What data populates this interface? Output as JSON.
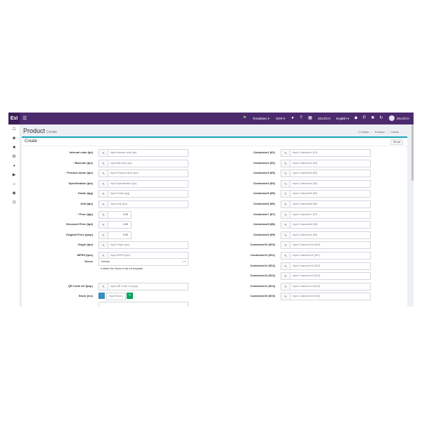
{
  "app": {
    "brand": "EsI",
    "menu_icon": "hamburger-icon",
    "top": {
      "templates": "Templates",
      "currency": "SGR",
      "user_label": "2014/CH",
      "language": "English",
      "user_name": "2014/CH"
    }
  },
  "page": {
    "title": "Product",
    "subtitle": "Create",
    "breadcrumb": [
      "Home",
      "Product",
      "Create"
    ]
  },
  "box": {
    "title": "Create",
    "list_label": "List"
  },
  "left_fields": [
    {
      "label": "Internal code (Ipi)",
      "required": false,
      "placeholder": "Input Internal code (Ipi)"
    },
    {
      "label": "Barcode (Ipc)",
      "required": true,
      "placeholder": "Input Barcode (Ipc)"
    },
    {
      "label": "Product name (Ipn)",
      "required": true,
      "placeholder": "Input Product name (Ipn)"
    },
    {
      "label": "Specification (Ips)",
      "required": false,
      "placeholder": "Input Specification (Ips)"
    },
    {
      "label": "Grade (Ipg)",
      "required": false,
      "placeholder": "Input Grade (Ipg)"
    },
    {
      "label": "Unit (Ipu)",
      "required": false,
      "placeholder": "Input Unit (Ipu)"
    },
    {
      "label": "Price (Ipp)",
      "required": true,
      "value": "0.00"
    },
    {
      "label": "Discount Price (Ipd)",
      "required": false,
      "value": "0.00"
    },
    {
      "label": "Original Price (Ipop)",
      "required": false,
      "value": "0.00"
    },
    {
      "label": "Origin (Ipo)",
      "required": false,
      "placeholder": "Input Origin (Ipo)"
    },
    {
      "label": "MFRS (Ipm)",
      "required": false,
      "placeholder": "Input MFRS (Ipm)"
    }
  ],
  "scene": {
    "label": "Scene",
    "value": "Normal",
    "note": "Match the Scene in the ed template"
  },
  "qr": {
    "label": "QR Code Url (Ipqr)",
    "placeholder": "Input QR Code Url (Ipqr)"
  },
  "stock": {
    "label": "Stock (Ivc)",
    "placeholder": "Input Stock (",
    "plus": "+"
  },
  "right_fields": [
    {
      "label": "Customize1 (If1)",
      "placeholder": "Input Customize1 (If1)"
    },
    {
      "label": "Customize2 (If2)",
      "placeholder": "Input Customize2 (If2)"
    },
    {
      "label": "Customize3 (If3)",
      "placeholder": "Input Customize3 (If3)"
    },
    {
      "label": "Customize4 (If4)",
      "placeholder": "Input Customize4 (If4)"
    },
    {
      "label": "Customize5 (If5)",
      "placeholder": "Input Customize5 (If5)"
    },
    {
      "label": "Customize6 (If6)",
      "placeholder": "Input Customize6 (If6)"
    },
    {
      "label": "Customize7 (If7)",
      "placeholder": "Input Customize7 (If7)"
    },
    {
      "label": "Customize8 (If8)",
      "placeholder": "Input Customize8 (If8)"
    },
    {
      "label": "Customize9 (If9)",
      "placeholder": "Input Customize9 (If9)"
    },
    {
      "label": "Customize10 (If10)",
      "placeholder": "Input Customize10 (If10)"
    },
    {
      "label": "Customize11 (If11)",
      "placeholder": "Input Customize11 (If11)"
    },
    {
      "label": "Customize12 (If12)",
      "placeholder": "Input Customize12 (If12)"
    },
    {
      "label": "Customize13 (If13)",
      "placeholder": "Input Customize13 (If13)"
    },
    {
      "label": "Customize14 (If14)",
      "placeholder": "Input Customize14 (If14)"
    },
    {
      "label": "Customize15 (If15)",
      "placeholder": "Input Customize15 (If15)"
    }
  ],
  "colors": {
    "navbar": "#4c2a6e",
    "accent": "#17a2b8",
    "stock_minus": "#3c8dbc",
    "stock_plus": "#00a65a"
  }
}
